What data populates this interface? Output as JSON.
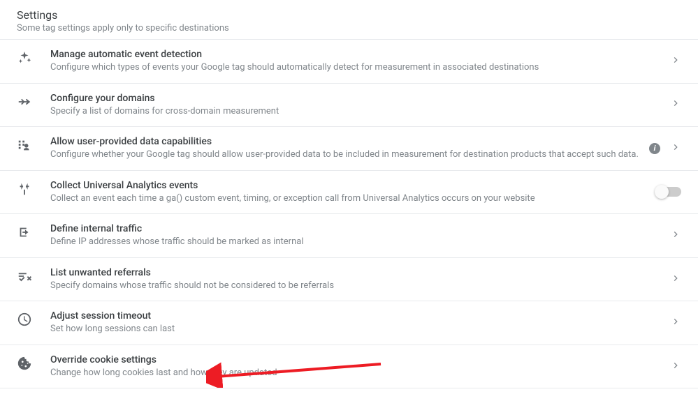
{
  "header": {
    "title": "Settings",
    "subtitle": "Some tag settings apply only to specific destinations"
  },
  "rows": [
    {
      "title": "Manage automatic event detection",
      "desc": "Configure which types of events your Google tag should automatically detect for measurement in associated destinations",
      "chevron": true
    },
    {
      "title": "Configure your domains",
      "desc": "Specify a list of domains for cross-domain measurement",
      "chevron": true
    },
    {
      "title": "Allow user-provided data capabilities",
      "desc": "Configure whether your Google tag should allow user-provided data to be included in measurement for destination products that accept such data.",
      "info": true,
      "chevron": true
    },
    {
      "title": "Collect Universal Analytics events",
      "desc": "Collect an event each time a ga() custom event, timing, or exception call from Universal Analytics occurs on your website",
      "toggle": true
    },
    {
      "title": "Define internal traffic",
      "desc": "Define IP addresses whose traffic should be marked as internal",
      "chevron": true
    },
    {
      "title": "List unwanted referrals",
      "desc": "Specify domains whose traffic should not be considered to be referrals",
      "chevron": true
    },
    {
      "title": "Adjust session timeout",
      "desc": "Set how long sessions can last",
      "chevron": true
    },
    {
      "title": "Override cookie settings",
      "desc": "Change how long cookies last and how they are updated",
      "chevron": true
    }
  ],
  "infoGlyph": "i"
}
